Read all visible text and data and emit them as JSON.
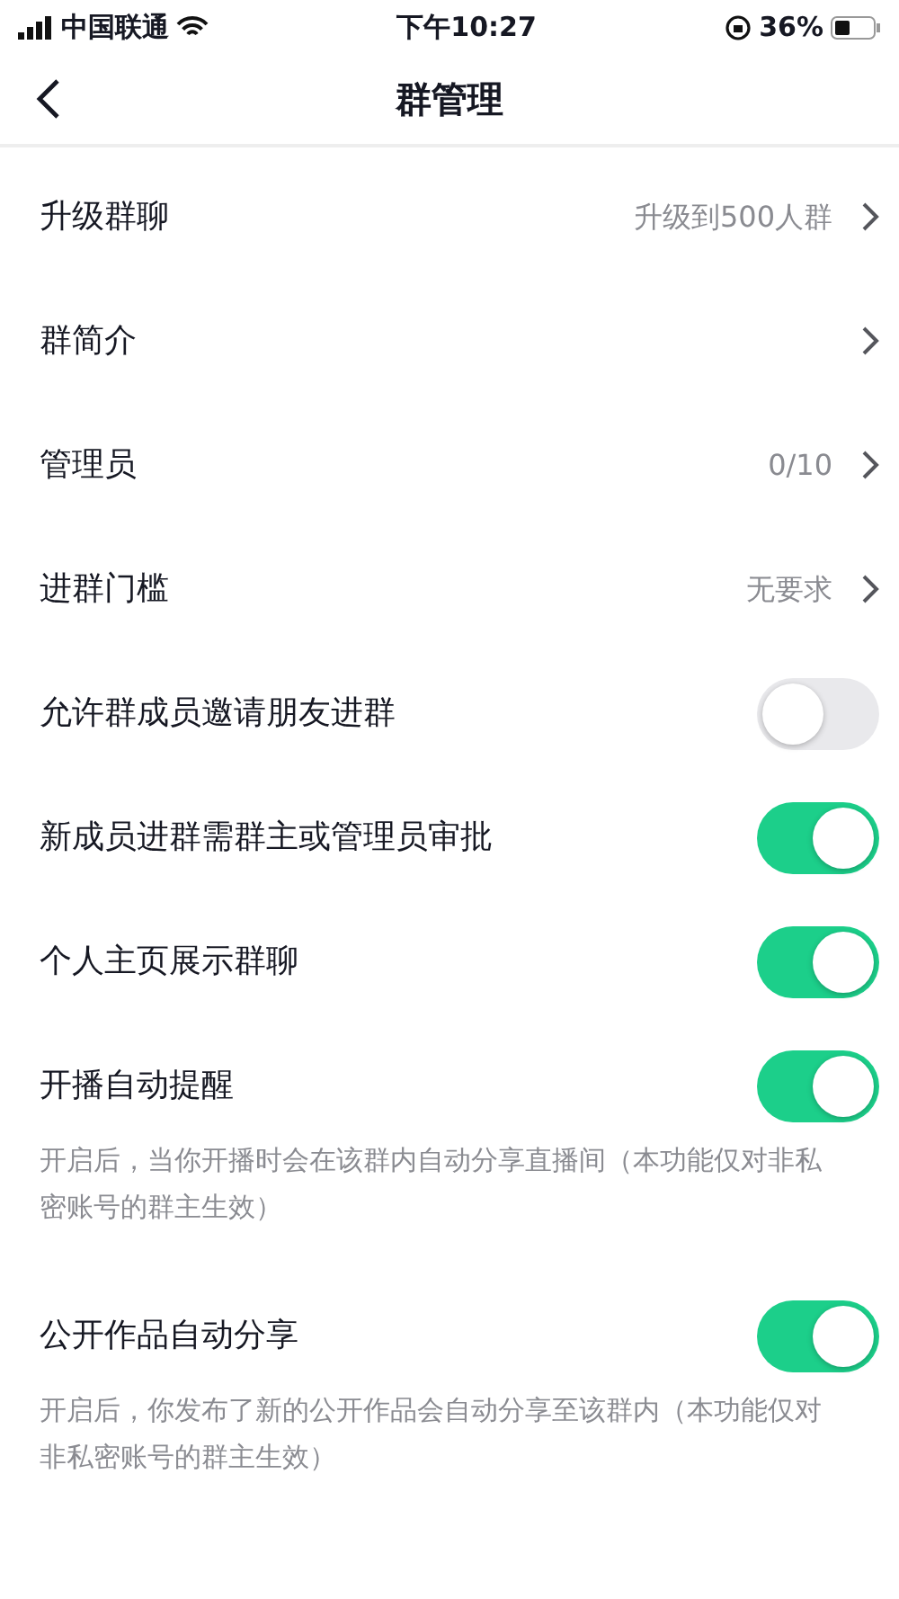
{
  "status_bar": {
    "carrier": "中国联通",
    "time": "下午10:27",
    "battery": "36%"
  },
  "nav": {
    "title": "群管理"
  },
  "rows": [
    {
      "kind": "link",
      "label": "升级群聊",
      "value": "升级到500人群"
    },
    {
      "kind": "link",
      "label": "群简介"
    },
    {
      "kind": "link",
      "label": "管理员",
      "value": "0/10"
    },
    {
      "kind": "link",
      "label": "进群门槛",
      "value": "无要求"
    },
    {
      "kind": "toggle",
      "label": "允许群成员邀请朋友进群",
      "on": false
    },
    {
      "kind": "toggle",
      "label": "新成员进群需群主或管理员审批",
      "on": true
    },
    {
      "kind": "toggle",
      "label": "个人主页展示群聊",
      "on": true
    },
    {
      "kind": "toggle",
      "label": "开播自动提醒",
      "on": true,
      "note": "开启后，当你开播时会在该群内自动分享直播间（本功能仅对非私密账号的群主生效）"
    },
    {
      "kind": "toggle",
      "label": "公开作品自动分享",
      "on": true,
      "note": "开启后，你发布了新的公开作品会自动分享至该群内（本功能仅对非私密账号的群主生效）"
    }
  ]
}
